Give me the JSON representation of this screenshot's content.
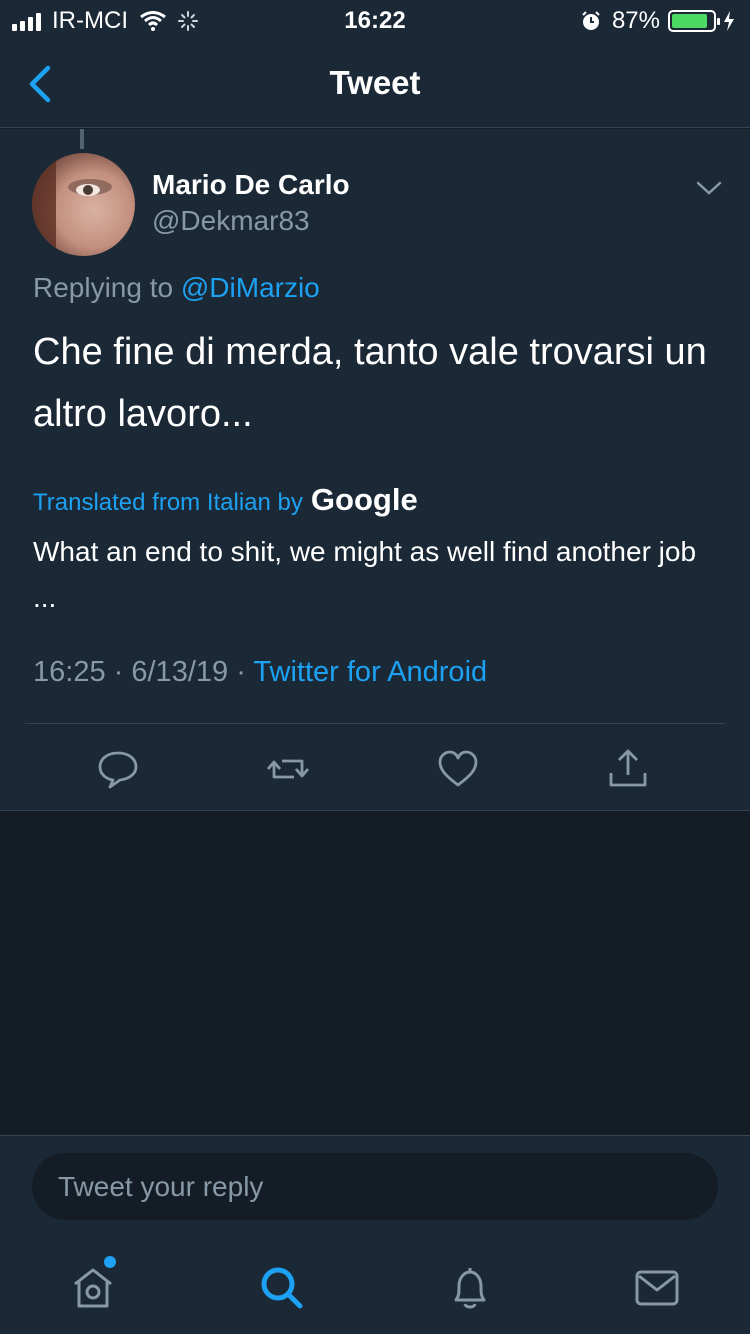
{
  "status_bar": {
    "carrier": "IR-MCI",
    "time": "16:22",
    "battery_percent": "87%",
    "battery_level": 0.87
  },
  "nav": {
    "title": "Tweet"
  },
  "tweet": {
    "author_name": "Mario De Carlo",
    "author_handle": "@Dekmar83",
    "replying_prefix": "Replying to",
    "replying_to": "@DiMarzio",
    "text": "Che fine di merda, tanto vale trovarsi un altro lavoro...",
    "translated_label": "Translated from Italian by",
    "translator": "Google",
    "translation": "What an end to shit, we might as well find another job ...",
    "time": "16:25",
    "date": "6/13/19",
    "separator": "·",
    "source": "Twitter for Android"
  },
  "reply": {
    "placeholder": "Tweet your reply"
  },
  "colors": {
    "background": "#141d26",
    "surface": "#1b2836",
    "accent": "#1da1f2",
    "secondary_text": "#8899a6",
    "battery": "#4cd964"
  },
  "icons": {
    "back": "chevron-left-icon",
    "caret": "chevron-down-icon",
    "reply": "comment-icon",
    "retweet": "retweet-icon",
    "like": "heart-icon",
    "share": "share-icon",
    "home": "home-icon",
    "search": "search-icon",
    "notifications": "bell-icon",
    "messages": "mail-icon"
  }
}
